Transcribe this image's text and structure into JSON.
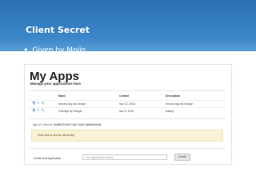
{
  "slide": {
    "title": "Client Secret",
    "bullet": "Given by Mojio",
    "bullet_glyph": "•"
  },
  "screenshot": {
    "heading": "My Apps",
    "subheading": "Manage your applications here",
    "table": {
      "columns": [
        "Name",
        "Created",
        "Description"
      ],
      "rows": [
        {
          "name": "Second App by George",
          "created": "Nov 12, 2016",
          "description": "Second App by George"
        },
        {
          "name": "First App by George",
          "created": "Nov 9, 2016",
          "description": "testing"
        }
      ]
    },
    "app_id_label": "App Id / Client Id:",
    "app_id_value": "9ad8f978-8097-4df7-92b3-3af6fb2ede8e",
    "secret_link": "Click here to see the secret key",
    "create": {
      "label": "Create New Application",
      "placeholder": "Your Application's Name",
      "button": "Create"
    }
  },
  "colors": {
    "banner": "#2a6fb4",
    "action_icons": "#3a7fc1",
    "secret_box_bg": "#f8f2d6"
  },
  "icons": {
    "delete": "trash-icon",
    "edit": "pencil-icon",
    "settings": "wrench-icon"
  }
}
